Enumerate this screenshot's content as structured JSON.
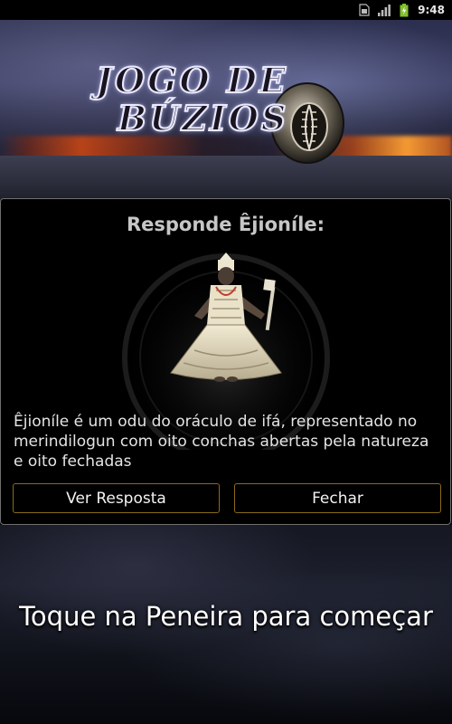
{
  "status_bar": {
    "time": "9:48",
    "icons": [
      "sim-icon",
      "signal-icon",
      "battery-charging-icon"
    ]
  },
  "logo": {
    "line1": "JOGO DE",
    "line2": "BÚZIOS"
  },
  "dialog": {
    "title": "Responde Êjioníle:",
    "image": "orixa-figure-icon",
    "message": "Êjioníle é um odu do oráculo de ifá, representado no merindilogun com oito conchas abertas pela natureza e oito fechadas",
    "buttons": {
      "answer": "Ver Resposta",
      "close": "Fechar"
    }
  },
  "prompt": "Toque na Peneira para começar",
  "colors": {
    "dialog_background": "#000000",
    "dialog_border": "#6f6f6f",
    "button_border": "#8a6b16",
    "title_color": "#c6c6c6"
  }
}
